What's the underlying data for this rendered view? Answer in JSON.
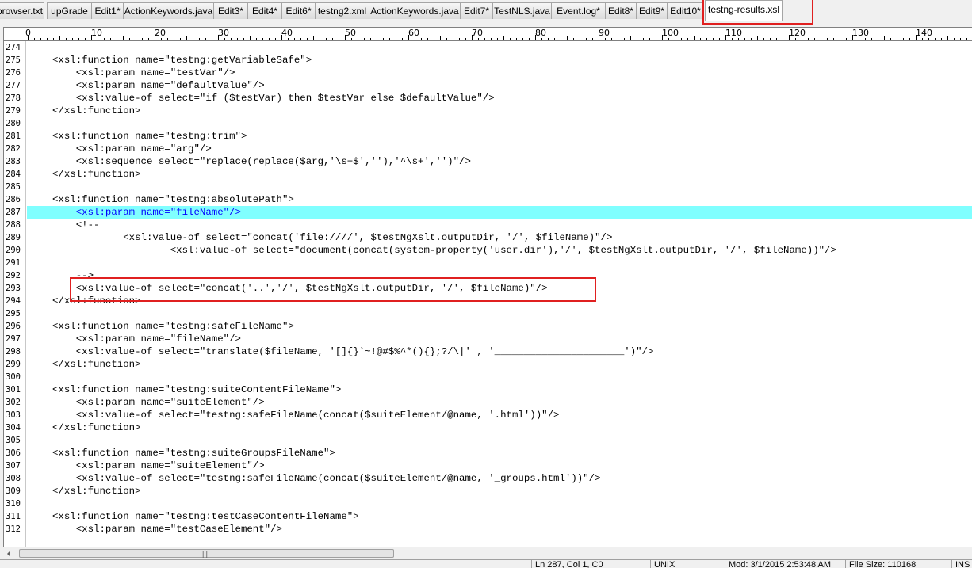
{
  "tabs": [
    {
      "label": "browser.txt",
      "active": false
    },
    {
      "label": "upGrade",
      "active": false
    },
    {
      "label": "Edit1*",
      "active": false
    },
    {
      "label": "ActionKeywords.java",
      "active": false
    },
    {
      "label": "Edit3*",
      "active": false
    },
    {
      "label": "Edit4*",
      "active": false
    },
    {
      "label": "Edit6*",
      "active": false
    },
    {
      "label": "testng2.xml",
      "active": false
    },
    {
      "label": "ActionKeywords.java",
      "active": false
    },
    {
      "label": "Edit7*",
      "active": false
    },
    {
      "label": "TestNLS.java",
      "active": false
    },
    {
      "label": "Event.log*",
      "active": false
    },
    {
      "label": "Edit8*",
      "active": false
    },
    {
      "label": "Edit9*",
      "active": false
    },
    {
      "label": "Edit10*",
      "active": false
    },
    {
      "label": "testng-results.xsl",
      "active": true
    }
  ],
  "ruler": {
    "labels": [
      "0",
      "10",
      "20",
      "30",
      "40",
      "50",
      "60",
      "70",
      "80",
      "90",
      "100",
      "110",
      "120",
      "130",
      "140"
    ]
  },
  "lines": [
    {
      "num": "274",
      "text": ""
    },
    {
      "num": "275",
      "text": "<xsl:function name=\"testng:getVariableSafe\">"
    },
    {
      "num": "276",
      "text": "    <xsl:param name=\"testVar\"/>"
    },
    {
      "num": "277",
      "text": "    <xsl:param name=\"defaultValue\"/>"
    },
    {
      "num": "278",
      "text": "    <xsl:value-of select=\"if ($testVar) then $testVar else $defaultValue\"/>"
    },
    {
      "num": "279",
      "text": "</xsl:function>"
    },
    {
      "num": "280",
      "text": ""
    },
    {
      "num": "281",
      "text": "<xsl:function name=\"testng:trim\">"
    },
    {
      "num": "282",
      "text": "    <xsl:param name=\"arg\"/>"
    },
    {
      "num": "283",
      "text": "    <xsl:sequence select=\"replace(replace($arg,'\\s+$',''),'^\\s+','')\"/>"
    },
    {
      "num": "284",
      "text": "</xsl:function>"
    },
    {
      "num": "285",
      "text": ""
    },
    {
      "num": "286",
      "text": "<xsl:function name=\"testng:absolutePath\">"
    },
    {
      "num": "287",
      "text": "    <xsl:param name=\"fileName\"/>"
    },
    {
      "num": "288",
      "text": "    <!--"
    },
    {
      "num": "289",
      "text": "            <xsl:value-of select=\"concat('file:////', $testNgXslt.outputDir, '/', $fileName)\"/>"
    },
    {
      "num": "290",
      "text": "                    <xsl:value-of select=\"document(concat(system-property('user.dir'),'/', $testNgXslt.outputDir, '/', $fileName))\"/>"
    },
    {
      "num": "291",
      "text": ""
    },
    {
      "num": "292",
      "text": "    -->"
    },
    {
      "num": "293",
      "text": "    <xsl:value-of select=\"concat('..','/', $testNgXslt.outputDir, '/', $fileName)\"/>"
    },
    {
      "num": "294",
      "text": "</xsl:function>"
    },
    {
      "num": "295",
      "text": ""
    },
    {
      "num": "296",
      "text": "<xsl:function name=\"testng:safeFileName\">"
    },
    {
      "num": "297",
      "text": "    <xsl:param name=\"fileName\"/>"
    },
    {
      "num": "298",
      "text": "    <xsl:value-of select=\"translate($fileName, '[]{}`~!@#$%^*(){};?/\\|' , '______________________')\"/>"
    },
    {
      "num": "299",
      "text": "</xsl:function>"
    },
    {
      "num": "300",
      "text": ""
    },
    {
      "num": "301",
      "text": "<xsl:function name=\"testng:suiteContentFileName\">"
    },
    {
      "num": "302",
      "text": "    <xsl:param name=\"suiteElement\"/>"
    },
    {
      "num": "303",
      "text": "    <xsl:value-of select=\"testng:safeFileName(concat($suiteElement/@name, '.html'))\"/>"
    },
    {
      "num": "304",
      "text": "</xsl:function>"
    },
    {
      "num": "305",
      "text": ""
    },
    {
      "num": "306",
      "text": "<xsl:function name=\"testng:suiteGroupsFileName\">"
    },
    {
      "num": "307",
      "text": "    <xsl:param name=\"suiteElement\"/>"
    },
    {
      "num": "308",
      "text": "    <xsl:value-of select=\"testng:safeFileName(concat($suiteElement/@name, '_groups.html'))\"/>"
    },
    {
      "num": "309",
      "text": "</xsl:function>"
    },
    {
      "num": "310",
      "text": ""
    },
    {
      "num": "311",
      "text": "<xsl:function name=\"testng:testCaseContentFileName\">"
    },
    {
      "num": "312",
      "text": "    <xsl:param name=\"testCaseElement\"/>"
    }
  ],
  "highlighted_line": "287",
  "scrollbar": {
    "grip": "|||"
  },
  "status": [
    "Ln 287, Col 1, C0",
    "UNIX",
    "Mod: 3/1/2015 2:53:48 AM",
    "File Size: 110168",
    "INS"
  ],
  "colors": {
    "highlight": "#80ffff",
    "annotation": "#e02020",
    "highlight_text": "#0000ff"
  }
}
